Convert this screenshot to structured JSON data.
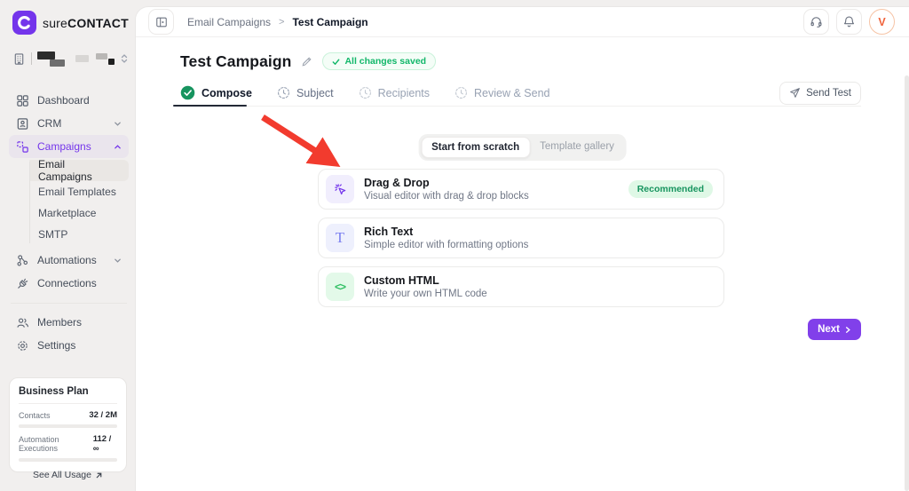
{
  "brand": {
    "name_regular": "sure",
    "name_bold": "CONTACT",
    "logo_icon": "c-ring-icon"
  },
  "topbar": {
    "toggle_icon": "sidebar-panel-icon",
    "breadcrumb": {
      "parent": "Email Campaigns",
      "separator": ">",
      "current": "Test Campaign"
    },
    "actions": {
      "support_icon": "headset-icon",
      "notifications_icon": "bell-icon",
      "avatar_initial": "V"
    }
  },
  "sidebar": {
    "nav": [
      {
        "label": "Dashboard",
        "icon": "grid-icon"
      },
      {
        "label": "CRM",
        "icon": "id-card-icon",
        "chevron": "down"
      },
      {
        "label": "Campaigns",
        "icon": "blocks-icon",
        "chevron": "up",
        "active": true
      },
      {
        "label": "Automations",
        "icon": "sitemap-icon",
        "chevron": "down"
      },
      {
        "label": "Connections",
        "icon": "plug-icon"
      },
      {
        "label": "Members",
        "icon": "people-icon"
      },
      {
        "label": "Settings",
        "icon": "gear-icon"
      }
    ],
    "campaigns_sub": [
      {
        "label": "Email Campaigns",
        "selected": true
      },
      {
        "label": "Email Templates"
      },
      {
        "label": "Marketplace"
      },
      {
        "label": "SMTP"
      }
    ],
    "plan": {
      "name": "Business Plan",
      "metrics": [
        {
          "label": "Contacts",
          "value": "32 / 2M"
        },
        {
          "label": "Automation Executions",
          "value": "112 / ∞"
        }
      ],
      "footer_link": "See All Usage"
    }
  },
  "page": {
    "title": "Test Campaign",
    "status_badge": "All changes saved",
    "steps": [
      {
        "label": "Compose",
        "status": "active"
      },
      {
        "label": "Subject",
        "status": "upcoming"
      },
      {
        "label": "Recipients",
        "status": "upcoming"
      },
      {
        "label": "Review & Send",
        "status": "upcoming"
      }
    ],
    "send_test_label": "Send Test",
    "next_label": "Next",
    "next_chevron": "›"
  },
  "composer": {
    "mode_toggle": [
      {
        "label": "Start from scratch",
        "selected": true
      },
      {
        "label": "Template gallery",
        "selected": false
      }
    ],
    "editor_options": [
      {
        "title": "Drag & Drop",
        "description": "Visual editor with drag & drop blocks",
        "badge": "Recommended",
        "icon": "cursor-click-icon"
      },
      {
        "title": "Rich Text",
        "description": "Simple editor with formatting options",
        "icon": "serif-t-icon",
        "glyph": "T"
      },
      {
        "title": "Custom HTML",
        "description": "Write your own HTML code",
        "icon": "code-icon",
        "glyph": "<>"
      }
    ]
  },
  "colors": {
    "brand_purple": "#7435eb",
    "success_green": "#12b76a",
    "annotation_arrow_red": "#f23b2e",
    "avatar_orange": "#f0633c"
  }
}
